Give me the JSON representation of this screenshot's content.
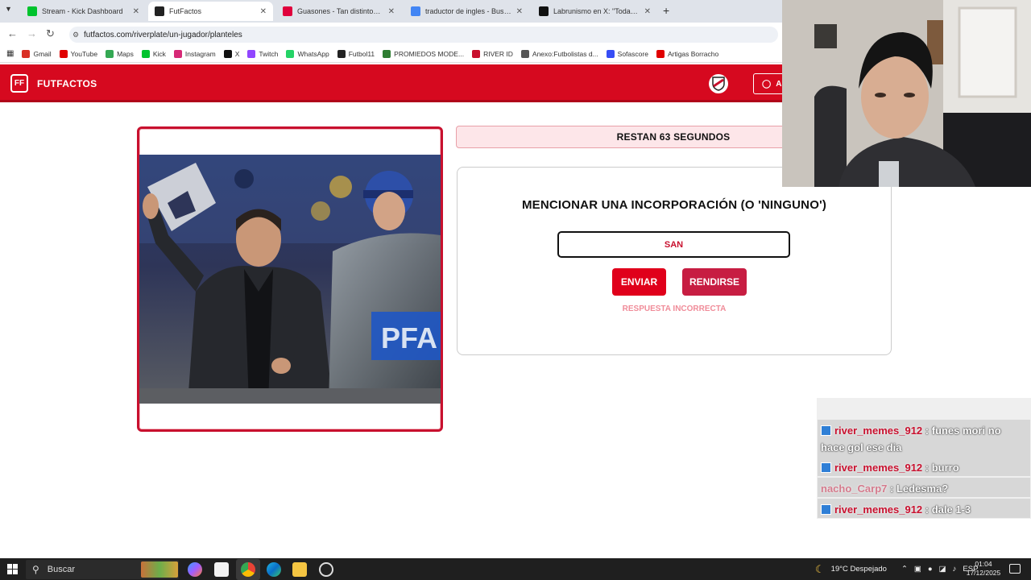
{
  "browser": {
    "tabs": [
      {
        "title": "Stream - Kick Dashboard",
        "icon": "kick-icon",
        "color": "#00c32d",
        "active": false
      },
      {
        "title": "FutFactos",
        "icon": "futfactos-icon",
        "color": "#222222",
        "active": true
      },
      {
        "title": "Guasones - Tan distintos Ft.",
        "icon": "youtube-icon",
        "color": "#e0003c",
        "active": false
      },
      {
        "title": "traductor de ingles - Buscar con",
        "icon": "google-icon",
        "color": "#4285f4",
        "active": false
      },
      {
        "title": "Labrunismo en X: \"Toda la vida",
        "icon": "x-icon",
        "color": "#111111",
        "active": false
      }
    ],
    "new_tab": "+",
    "url": "futfactos.com/riverplate/un-jugador/planteles",
    "bookmarks": [
      {
        "label": "Gmail",
        "color": "#d93025"
      },
      {
        "label": "YouTube",
        "color": "#e00000"
      },
      {
        "label": "Maps",
        "color": "#34a853"
      },
      {
        "label": "Kick",
        "color": "#00c32d"
      },
      {
        "label": "Instagram",
        "color": "#d62976"
      },
      {
        "label": "X",
        "color": "#111111"
      },
      {
        "label": "Twitch",
        "color": "#9146ff"
      },
      {
        "label": "WhatsApp",
        "color": "#25d366"
      },
      {
        "label": "Futbol11",
        "color": "#222222"
      },
      {
        "label": "PROMIEDOS MODE...",
        "color": "#2e7d32"
      },
      {
        "label": "RIVER ID",
        "color": "#c8102e"
      },
      {
        "label": "Anexo:Futbolistas d...",
        "color": "#555555"
      },
      {
        "label": "Sofascore",
        "color": "#374df5"
      },
      {
        "label": "Artigas Borracho",
        "color": "#e00000"
      }
    ]
  },
  "site": {
    "brand": "FUTFACTOS",
    "brand_color": "#d6091f",
    "account_button": "A"
  },
  "game": {
    "timer": "RESTAN 63 SEGUNDOS",
    "question": "MENCIONAR UNA INCORPORACIÓN (O 'NINGUNO')",
    "answer_value": "SAN",
    "send_label": "ENVIAR",
    "give_up_label": "RENDIRSE",
    "feedback": "RESPUESTA INCORRECTA",
    "photo_text": "PFA"
  },
  "chat": [
    {
      "user": "river_memes_912",
      "message": "funes mori no hace gol ese dia",
      "badge": true
    },
    {
      "user": "river_memes_912",
      "message": "burro",
      "badge": true
    },
    {
      "user": "nacho_Carp7",
      "message": "Ledesma?",
      "badge": false
    },
    {
      "user": "river_memes_912",
      "message": "dale 1-3",
      "badge": true
    }
  ],
  "taskbar": {
    "search_label": "Buscar",
    "weather": "19°C  Despejado",
    "lang": "ESP",
    "time": "01:04",
    "date": "17/12/2025"
  }
}
